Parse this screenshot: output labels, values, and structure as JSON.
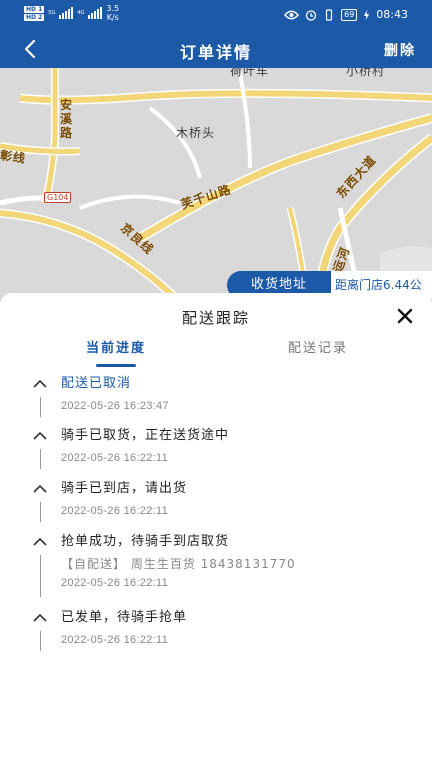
{
  "status_bar": {
    "hd1": "HD 1",
    "hd2": "HD 2",
    "net1": "5G",
    "net2": "4G",
    "speed_value": "3.5",
    "speed_unit": "K/s",
    "battery": "69",
    "time": "08:43"
  },
  "header": {
    "title": "订单详情",
    "delete_label": "删除"
  },
  "map": {
    "place_labels": [
      "荷叶车",
      "小桥村",
      "木桥头"
    ],
    "road_labels": [
      "安溪路",
      "彰线",
      "东西大道",
      "芙千山路",
      "京良线",
      "运河"
    ],
    "highway_badge": "G104",
    "address_button": "收货地址",
    "distance_text": "距离门店6.44公"
  },
  "sheet": {
    "title": "配送跟踪",
    "tabs": [
      {
        "label": "当前进度",
        "active": true
      },
      {
        "label": "配送记录",
        "active": false
      }
    ],
    "steps": [
      {
        "title": "配送已取消",
        "time": "2022-05-26 16:23:47",
        "active": true,
        "detail": ""
      },
      {
        "title": "骑手已取货，正在送货途中",
        "time": "2022-05-26 16:22:11",
        "active": false,
        "detail": ""
      },
      {
        "title": "骑手已到店，请出货",
        "time": "2022-05-26 16:22:11",
        "active": false,
        "detail": ""
      },
      {
        "title": "抢单成功，待骑手到店取货",
        "time": "2022-05-26 16:22:11",
        "active": false,
        "detail": "【自配送】 周生生百货 18438131770"
      },
      {
        "title": "已发单，待骑手抢单",
        "time": "2022-05-26 16:22:11",
        "active": false,
        "detail": ""
      }
    ]
  },
  "colors": {
    "primary": "#1c5aa8",
    "map_bg": "#d9d9d9",
    "road": "#f2d678"
  }
}
